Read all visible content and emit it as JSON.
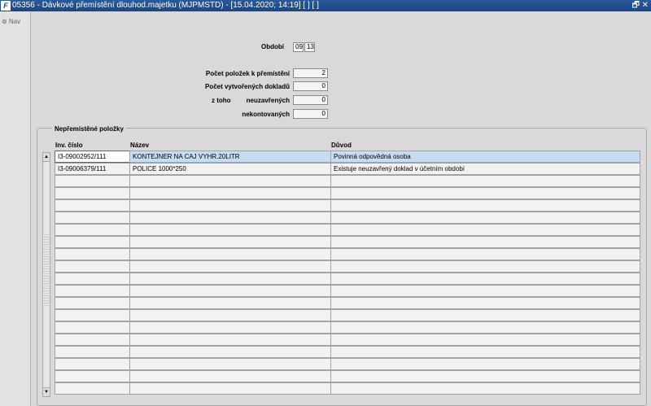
{
  "window": {
    "app_icon": "F",
    "title": "05356 - Dávkové přemístění dlouhod.majetku (MJPMSTD) - [15.04.2020; 14:19]  [ ]  [ ]",
    "restore_glyph": "🗗",
    "close_glyph": "✕"
  },
  "nav": {
    "label": "Nav"
  },
  "form": {
    "obdobi_label": "Období",
    "obdobi_month": "09",
    "obdobi_year": "13",
    "pocet_polozek_label": "Počet položek k přemístění",
    "pocet_polozek_value": "2",
    "pocet_dokladu_label": "Počet vytvořených dokladů",
    "pocet_dokladu_value": "0",
    "ztoho_label": "z toho",
    "neuzavrenych_label": "neuzavřených",
    "neuzavrenych_value": "0",
    "nekontovanych_label": "nekontovaných",
    "nekontovanych_value": "0"
  },
  "grid": {
    "title": "Nepřemístěné položky",
    "columns": [
      "Inv. číslo",
      "Název",
      "Důvod"
    ],
    "rows": [
      [
        "I3-09002952/111",
        "KONTEJNER NA CAJ VYHR.20LITR",
        "Povinná odpovědná osoba"
      ],
      [
        "I3-09006379/111",
        "POLICE 1000*250",
        "Existuje neuzavřený doklad v účetním období"
      ],
      [
        "",
        "",
        ""
      ],
      [
        "",
        "",
        ""
      ],
      [
        "",
        "",
        ""
      ],
      [
        "",
        "",
        ""
      ],
      [
        "",
        "",
        ""
      ],
      [
        "",
        "",
        ""
      ],
      [
        "",
        "",
        ""
      ],
      [
        "",
        "",
        ""
      ],
      [
        "",
        "",
        ""
      ],
      [
        "",
        "",
        ""
      ],
      [
        "",
        "",
        ""
      ],
      [
        "",
        "",
        ""
      ],
      [
        "",
        "",
        ""
      ],
      [
        "",
        "",
        ""
      ],
      [
        "",
        "",
        ""
      ],
      [
        "",
        "",
        ""
      ],
      [
        "",
        "",
        ""
      ],
      [
        "",
        "",
        ""
      ]
    ],
    "scroll_up_glyph": "▲",
    "scroll_down_glyph": "▼"
  },
  "colors": {
    "titlebar": "#1c4683",
    "selected_row": "#c5dcf2",
    "focus_border": "#dd3333"
  }
}
